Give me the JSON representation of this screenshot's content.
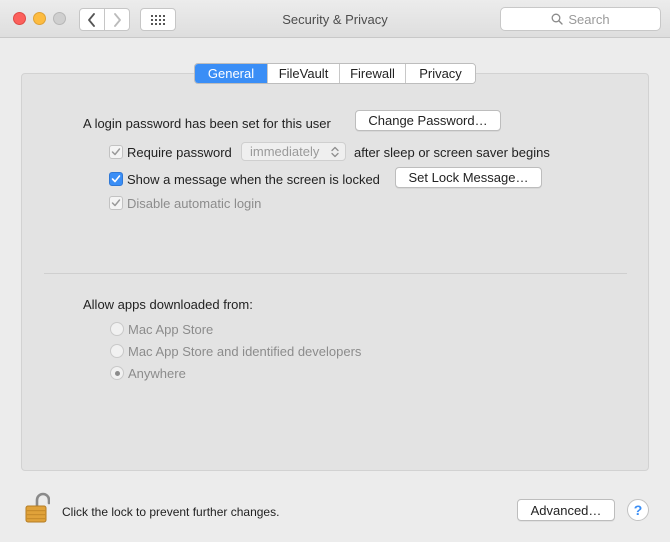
{
  "window": {
    "title": "Security & Privacy"
  },
  "toolbar": {
    "back_icon": "chevron-left-icon",
    "forward_icon": "chevron-right-icon",
    "grid_icon": "show-all-grid-icon",
    "search_placeholder": "Search"
  },
  "tabs": [
    {
      "label": "General",
      "active": true
    },
    {
      "label": "FileVault",
      "active": false
    },
    {
      "label": "Firewall",
      "active": false
    },
    {
      "label": "Privacy",
      "active": false
    }
  ],
  "general": {
    "login_password_text": "A login password has been set for this user",
    "change_password_button": "Change Password…",
    "require_password": {
      "label": "Require password",
      "checked": true,
      "enabled": false
    },
    "require_password_select": {
      "value": "immediately"
    },
    "after_sleep_text": "after sleep or screen saver begins",
    "show_message": {
      "label": "Show a message when the screen is locked",
      "checked": true,
      "enabled": true
    },
    "set_lock_message_button": "Set Lock Message…",
    "disable_auto_login": {
      "label": "Disable automatic login",
      "checked": true,
      "enabled": false
    }
  },
  "downloads": {
    "heading": "Allow apps downloaded from:",
    "options": [
      {
        "label": "Mac App Store",
        "selected": false
      },
      {
        "label": "Mac App Store and identified developers",
        "selected": false
      },
      {
        "label": "Anywhere",
        "selected": true
      }
    ]
  },
  "footer": {
    "lock_text": "Click the lock to prevent further changes.",
    "advanced_button": "Advanced…",
    "help_label": "?"
  },
  "colors": {
    "accent": "#3a8ef6",
    "lock": "#e0a23a"
  }
}
